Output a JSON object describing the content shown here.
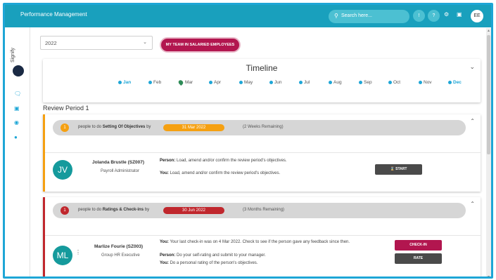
{
  "app": {
    "title": "Performance Management",
    "search_placeholder": "Search here...",
    "user_initials": "EE"
  },
  "topbar": {
    "circle1": "!",
    "circle2": "?",
    "icons": [
      "gear-icon",
      "notification-icon"
    ]
  },
  "sidebar": {
    "logo_text": "Signify",
    "icons": [
      "chat-icon",
      "briefcase-icon",
      "binoculars-icon",
      "person-icon"
    ]
  },
  "filters": {
    "year": "2022",
    "team_button": "MY TEAM IN SALARIED EMPLOYEES"
  },
  "timeline": {
    "title": "Timeline",
    "months": [
      {
        "label": "Jan",
        "bold": true
      },
      {
        "label": "Feb",
        "bold": false
      },
      {
        "label": "Mar",
        "bold": false,
        "current": true
      },
      {
        "label": "Apr",
        "bold": false
      },
      {
        "label": "May",
        "bold": false
      },
      {
        "label": "Jun",
        "bold": false
      },
      {
        "label": "Jul",
        "bold": false
      },
      {
        "label": "Aug",
        "bold": false
      },
      {
        "label": "Sep",
        "bold": false
      },
      {
        "label": "Oct",
        "bold": false
      },
      {
        "label": "Nov",
        "bold": false
      },
      {
        "label": "Dec",
        "bold": true
      }
    ]
  },
  "review_period": {
    "title": "Review Period 1",
    "tasks": [
      {
        "count": "1",
        "prefix": "people to do",
        "task_name": "Setting Of Objectives",
        "suffix": "by",
        "date": "31 Mar 2022",
        "remaining": "(2 Weeks Remaining)",
        "accent_color": "#f5a011",
        "employee": {
          "initials": "JV",
          "name": "Jolanda Brustle (SZ007)",
          "role": "Payroll Administrator"
        },
        "lines": [
          {
            "who": "Person:",
            "text": "Load, amend and/or confirm the review period's objectives."
          },
          {
            "who": "You:",
            "text": "Load, amend and/or confirm the review period's objectives."
          }
        ],
        "action": "START"
      },
      {
        "count": "1",
        "prefix": "people to do",
        "task_name": "Ratings & Check-ins",
        "suffix": "by",
        "date": "30 Jun 2022",
        "remaining": "(3 Months Remaining)",
        "accent_color": "#c0272d",
        "employee": {
          "initials": "ML",
          "name": "Marlize Fourie (SZ003)",
          "role": "Group HR Executive"
        },
        "lines": [
          {
            "who": "You:",
            "text": "Your last check-in was on 4 Mar 2022. Check to see if the person gave any feedback since then."
          },
          {
            "who": "Person:",
            "text": "Do your self-rating and submit to your manager."
          },
          {
            "who": "You:",
            "text": "Do a personal rating of the person's objectives."
          }
        ],
        "actions": [
          "CHECK-IN",
          "RATE"
        ]
      }
    ]
  }
}
